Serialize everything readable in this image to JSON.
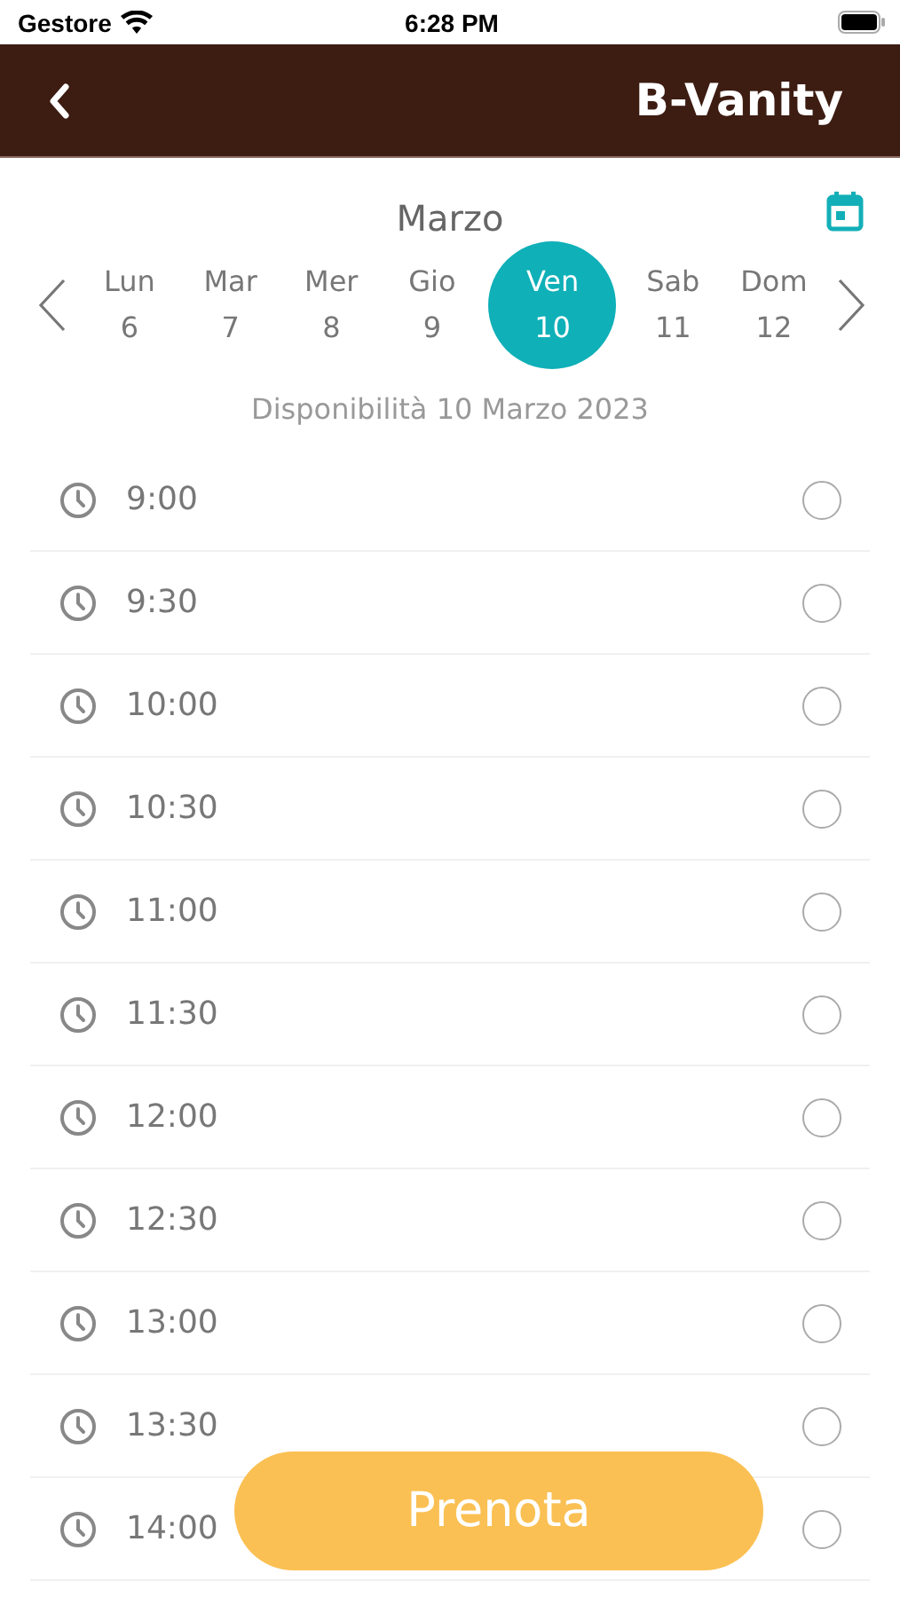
{
  "status_bar": {
    "carrier": "Gestore",
    "time": "6:28 PM"
  },
  "header": {
    "title": "B-Vanity"
  },
  "month": "Marzo",
  "days": [
    {
      "weekday": "Lun",
      "day": "6",
      "selected": false
    },
    {
      "weekday": "Mar",
      "day": "7",
      "selected": false
    },
    {
      "weekday": "Mer",
      "day": "8",
      "selected": false
    },
    {
      "weekday": "Gio",
      "day": "9",
      "selected": false
    },
    {
      "weekday": "Ven",
      "day": "10",
      "selected": true
    },
    {
      "weekday": "Sab",
      "day": "11",
      "selected": false
    },
    {
      "weekday": "Dom",
      "day": "12",
      "selected": false
    }
  ],
  "availability": "Disponibilità 10 Marzo 2023",
  "slots": [
    {
      "time": "9:00",
      "selected": false
    },
    {
      "time": "9:30",
      "selected": false
    },
    {
      "time": "10:00",
      "selected": false
    },
    {
      "time": "10:30",
      "selected": false
    },
    {
      "time": "11:00",
      "selected": false
    },
    {
      "time": "11:30",
      "selected": false
    },
    {
      "time": "12:00",
      "selected": false
    },
    {
      "time": "12:30",
      "selected": false
    },
    {
      "time": "13:00",
      "selected": false
    },
    {
      "time": "13:30",
      "selected": false
    },
    {
      "time": "14:00",
      "selected": false
    }
  ],
  "book_button": "Prenota"
}
